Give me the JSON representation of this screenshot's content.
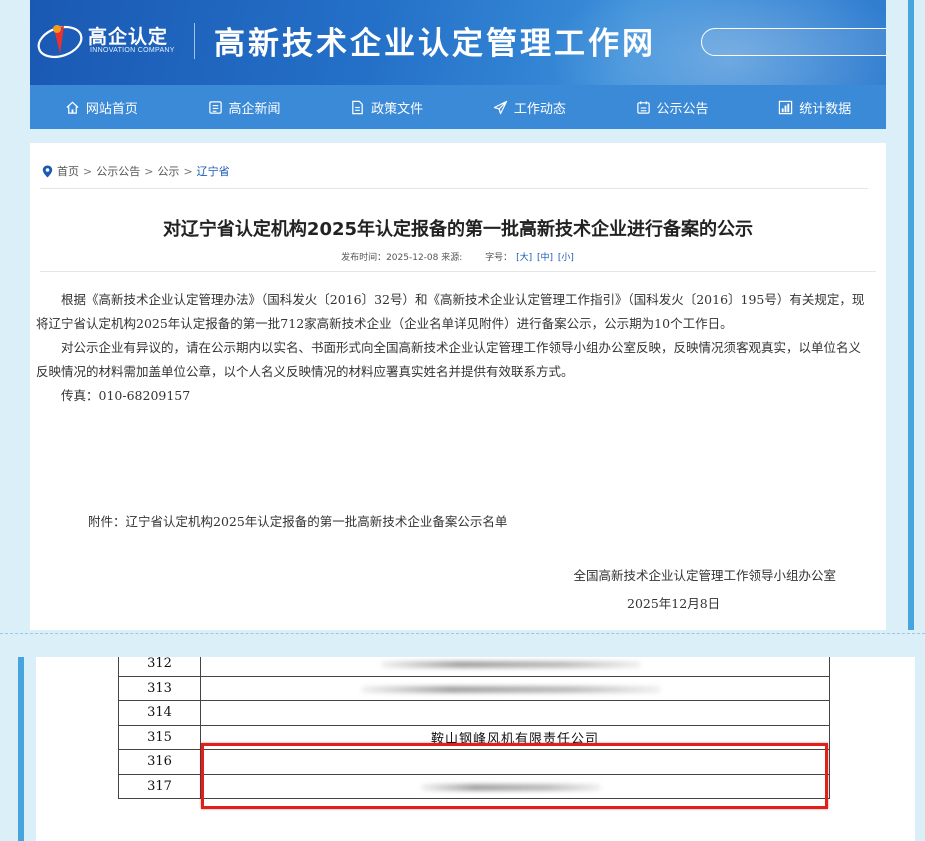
{
  "header": {
    "logo_cn": "高企认定",
    "logo_en": "INNOVATION COMPANY",
    "site_title": "高新技术企业认定管理工作网",
    "search_placeholder": ""
  },
  "nav": {
    "items": [
      {
        "label": "网站首页",
        "icon": "home-icon"
      },
      {
        "label": "高企新闻",
        "icon": "news-icon"
      },
      {
        "label": "政策文件",
        "icon": "document-icon"
      },
      {
        "label": "工作动态",
        "icon": "paper-plane-icon"
      },
      {
        "label": "公示公告",
        "icon": "notice-icon"
      },
      {
        "label": "统计数据",
        "icon": "statistics-icon"
      }
    ]
  },
  "breadcrumb": {
    "items": [
      "首页",
      "公示公告",
      "公示",
      "辽宁省"
    ],
    "separator": ">"
  },
  "article": {
    "title": "对辽宁省认定机构2025年认定报备的第一批高新技术企业进行备案的公示",
    "meta_publish": "发布时间：2025-12-08 来源:",
    "meta_size_label": "字号：",
    "size_large": "[大]",
    "size_medium": "[中]",
    "size_small": "[小]",
    "paragraphs": [
      "根据《高新技术企业认定管理办法》（国科发火〔2016〕32号）和《高新技术企业认定管理工作指引》（国科发火〔2016〕195号）有关规定，现将辽宁省认定机构2025年认定报备的第一批712家高新技术企业（企业名单详见附件）进行备案公示，公示期为10个工作日。",
      "对公示企业有异议的，请在公示期内以实名、书面形式向全国高新技术企业认定管理工作领导小组办公室反映，反映情况须客观真实，以单位名义反映情况的材料需加盖单位公章，以个人名义反映情况的材料应署真实姓名并提供有效联系方式。",
      "传真：010-68209157"
    ],
    "attachment": "附件：辽宁省认定机构2025年认定报备的第一批高新技术企业备案公示名单",
    "sign_org": "全国高新技术企业认定管理工作领导小组办公室",
    "sign_date": "2025年12月8日"
  },
  "table": {
    "rows": [
      {
        "num": "312",
        "name": ""
      },
      {
        "num": "313",
        "name": ""
      },
      {
        "num": "314",
        "name": ""
      },
      {
        "num": "315",
        "name": "鞍山钢峰风机有限责任公司"
      },
      {
        "num": "316",
        "name": ""
      },
      {
        "num": "317",
        "name": ""
      }
    ],
    "highlight_color": "#e0201a"
  },
  "colors": {
    "header_blue": "#1a59b3",
    "nav_blue": "#3b8ad8",
    "page_bg": "#dbeff8",
    "accent_bar": "#45a5dc"
  }
}
